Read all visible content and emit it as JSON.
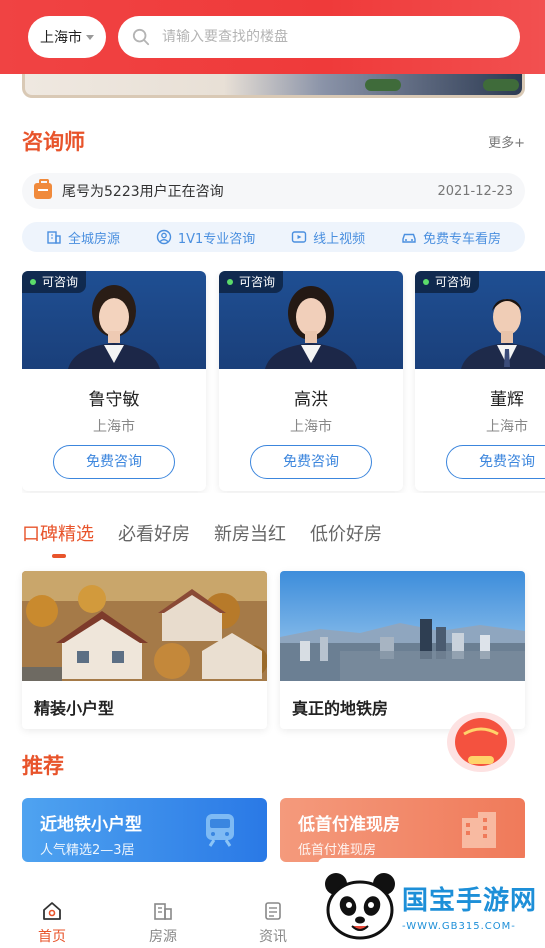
{
  "header": {
    "city": "上海市",
    "search_placeholder": "请输入要查找的楼盘"
  },
  "consultant": {
    "title": "咨询师",
    "more": "更多+",
    "notice_text": "尾号为5223用户正在咨询",
    "notice_date": "2021-12-23",
    "features": [
      "全城房源",
      "1V1专业咨询",
      "线上视频",
      "免费专车看房"
    ],
    "cards": [
      {
        "tag": "可咨询",
        "name": "鲁守敏",
        "city": "上海市",
        "button": "免费咨询"
      },
      {
        "tag": "可咨询",
        "name": "高洪",
        "city": "上海市",
        "button": "免费咨询"
      },
      {
        "tag": "可咨询",
        "name": "董辉",
        "city": "上海市",
        "button": "免费咨询"
      }
    ]
  },
  "tabs": [
    "口碑精选",
    "必看好房",
    "新房当红",
    "低价好房"
  ],
  "picks": [
    {
      "label": "精装小户型"
    },
    {
      "label": "真正的地铁房"
    }
  ],
  "recommend": {
    "title": "推荐",
    "items": [
      {
        "title": "近地铁小户型",
        "subtitle": "人气精选2—3居"
      },
      {
        "title": "低首付准现房",
        "subtitle": "低首付准现房"
      }
    ]
  },
  "bottom_nav": [
    "首页",
    "房源",
    "资讯"
  ],
  "watermark": {
    "brand": "国宝手游网",
    "url": "-WWW.GB315.COM-"
  },
  "colors": {
    "accent": "#e8542b",
    "blue": "#3c86dd",
    "header_red": "#ef3a3a"
  }
}
